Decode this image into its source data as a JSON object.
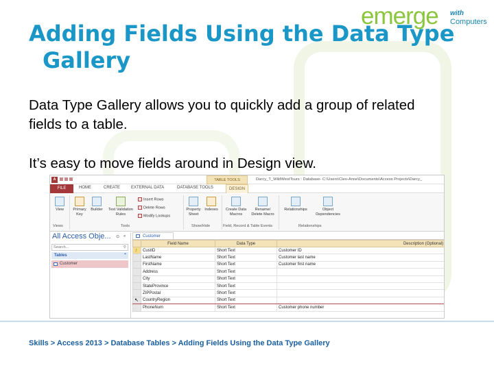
{
  "logo": {
    "main": "emerge",
    "with": "with",
    "computers": "Computers"
  },
  "slide": {
    "title_line1": "Adding Fields Using the Data Type",
    "title_line2": "Gallery",
    "para1": "Data Type Gallery allows you to quickly add a group of related fields to a table.",
    "para2": "It’s easy to move fields around in Design view.",
    "footer": "Skills > Access 2013 > Database Tables > Adding Fields Using the Data Type Gallery"
  },
  "colors": {
    "title": "#1a97c7",
    "logo_green": "#8cc63f",
    "logo_blue": "#1a86b0",
    "access_red": "#a4373a",
    "table_header": "#f4e3b8"
  },
  "access": {
    "app_icon": "A",
    "table_tools": "TABLE TOOLS",
    "window_title": "Darcy_T_WildWestTours : Database- C:\\Users\\Cleo-Anne\\Documents\\Access Projects\\Darcy_",
    "tabs": [
      "FILE",
      "HOME",
      "CREATE",
      "EXTERNAL DATA",
      "DATABASE TOOLS",
      "DESIGN"
    ],
    "ribbon": {
      "view": "View",
      "primary_key": "Primary Key",
      "builder": "Builder",
      "test_validation": "Test Validation Rules",
      "insert_rows": "Insert Rows",
      "delete_rows": "Delete Rows",
      "modify_lookups": "Modify Lookups",
      "property_sheet": "Property Sheet",
      "indexes": "Indexes",
      "create_data_macros": "Create Data Macros",
      "rename_delete_macro": "Rename/ Delete Macro",
      "relationships": "Relationships",
      "object_dependencies": "Object Dependencies",
      "groups": [
        "Views",
        "Tools",
        "Show/Hide",
        "Field, Record & Table Events",
        "Relationships"
      ]
    },
    "nav": {
      "title": "All Access Obje...",
      "dropdown_glyph": "⊙",
      "collapse_glyph": "«",
      "search_placeholder": "Search...",
      "search_glyph": "⚲",
      "section": "Tables",
      "section_glyph": "⌃",
      "item": "Customer"
    },
    "doc_tab": "Customer",
    "grid": {
      "headers": [
        "Field Name",
        "Data Type",
        "Description (Optional)"
      ],
      "rows": [
        {
          "field": "CustID",
          "type": "Short Text",
          "desc": "Customer ID"
        },
        {
          "field": "LastName",
          "type": "Short Text",
          "desc": "Customer last name"
        },
        {
          "field": "FirstName",
          "type": "Short Text",
          "desc": "Customer first name"
        },
        {
          "field": "Address",
          "type": "Short Text",
          "desc": ""
        },
        {
          "field": "City",
          "type": "Short Text",
          "desc": ""
        },
        {
          "field": "StateProvince",
          "type": "Short Text",
          "desc": ""
        },
        {
          "field": "ZIPPostal",
          "type": "Short Text",
          "desc": ""
        },
        {
          "field": "CountryRegion",
          "type": "Short Text",
          "desc": ""
        },
        {
          "field": "PhoneNum",
          "type": "Short Text",
          "desc": "Customer phone number"
        }
      ],
      "key_glyph": "⚷",
      "cursor_glyph": "↖"
    }
  }
}
